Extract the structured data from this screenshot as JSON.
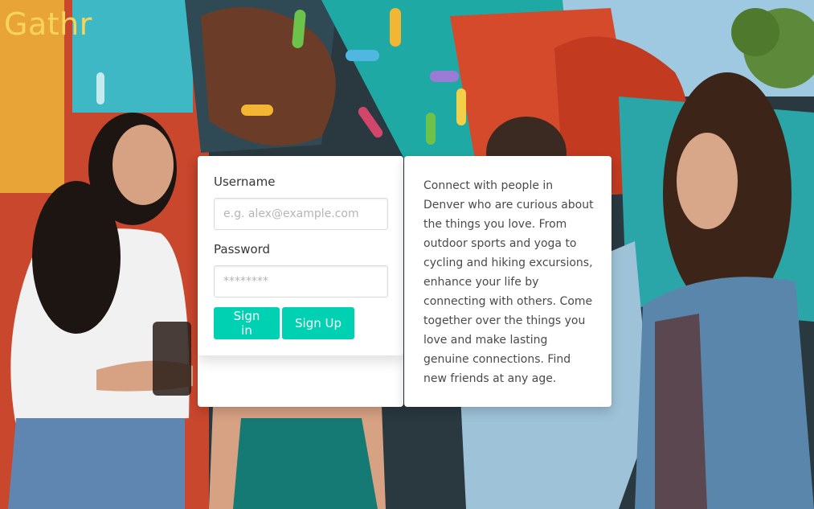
{
  "brand": {
    "logo_text": "Gathr",
    "accent": "#00d1b2",
    "logo_color": "#f6d55a"
  },
  "background": {
    "description_icon": "hero-photo"
  },
  "login": {
    "username_label": "Username",
    "username_placeholder": "e.g. alex@example.com",
    "username_value": "",
    "password_label": "Password",
    "password_placeholder": "********",
    "password_value": "",
    "signin_label": "Sign in",
    "signup_label": "Sign Up"
  },
  "info": {
    "text": "Connect with people in Denver who are curious about the things you love. From outdoor sports and yoga to cycling and hiking excursions, enhance your life by connecting with others. Come together over the things you love and make lasting genuine connections. Find new friends at any age."
  }
}
